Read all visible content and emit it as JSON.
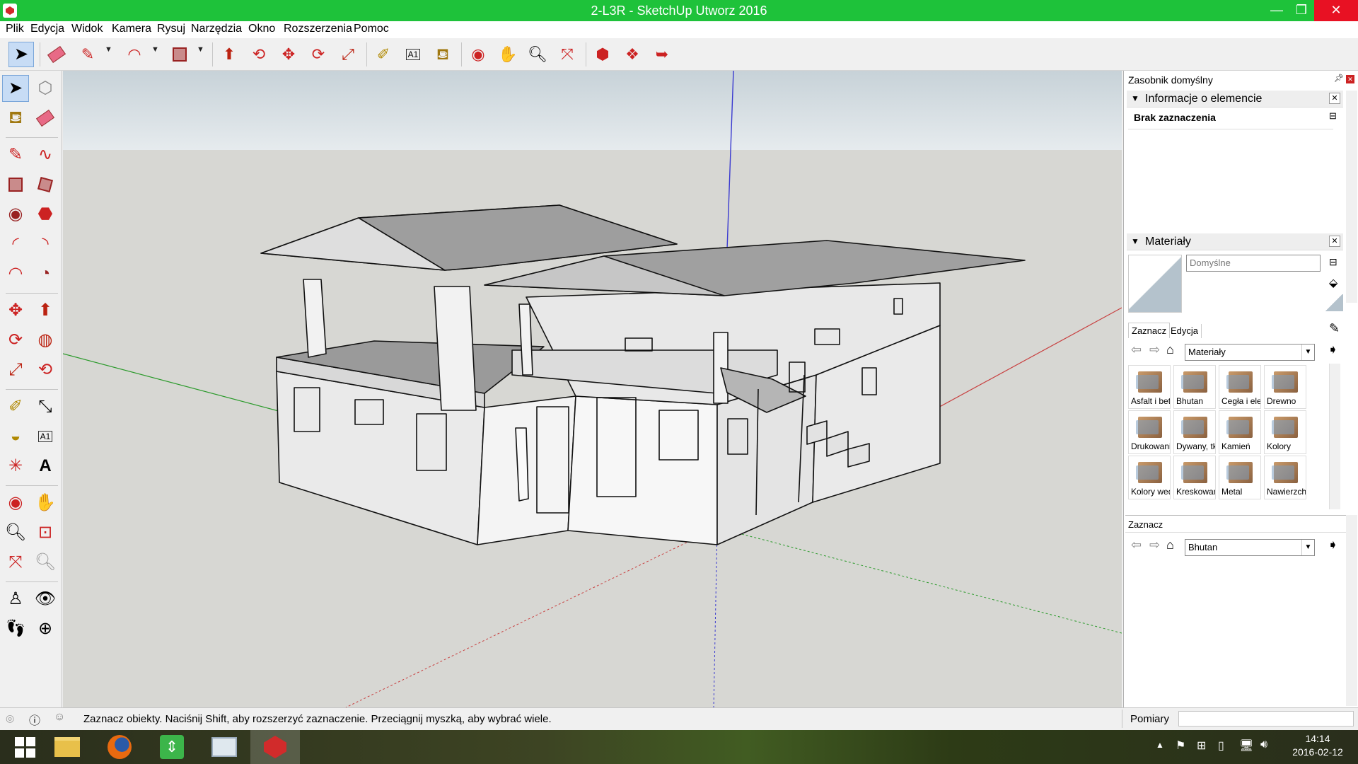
{
  "window": {
    "title": "2-L3R - SketchUp Utworz 2016",
    "accent": "#1ec23a"
  },
  "menu": [
    "Plik",
    "Edycja",
    "Widok",
    "Kamera",
    "Rysuj",
    "Narzędzia",
    "Okno",
    "Rozszerzenia",
    "Pomoc"
  ],
  "toolbar": {
    "tools": [
      {
        "name": "select-tool",
        "icon": "arrow-icon"
      },
      {
        "name": "eraser-tool",
        "icon": "eraser-icon"
      },
      {
        "name": "pencil-tool",
        "icon": "pencil-icon"
      },
      {
        "name": "arc-tool",
        "icon": "arc-icon"
      },
      {
        "name": "rectangle-tool",
        "icon": "rectangle-icon"
      },
      {
        "name": "push-pull-tool",
        "icon": "push-pull-icon"
      },
      {
        "name": "offset-tool",
        "icon": "offset-icon"
      },
      {
        "name": "move-tool",
        "icon": "move-icon"
      },
      {
        "name": "rotate-tool",
        "icon": "rotate-icon"
      },
      {
        "name": "scale-tool",
        "icon": "scale-icon"
      },
      {
        "name": "tape-measure-tool",
        "icon": "tape-icon"
      },
      {
        "name": "text-tool",
        "icon": "text-icon"
      },
      {
        "name": "paint-bucket-tool",
        "icon": "paint-bucket-icon"
      },
      {
        "name": "orbit-tool",
        "icon": "orbit-icon"
      },
      {
        "name": "pan-tool",
        "icon": "hand-icon"
      },
      {
        "name": "zoom-tool",
        "icon": "magnifier-icon"
      },
      {
        "name": "zoom-extents-tool",
        "icon": "zoom-extents-icon"
      },
      {
        "name": "warehouse-tool",
        "icon": "warehouse-icon"
      },
      {
        "name": "extension-warehouse-tool",
        "icon": "extension-icon"
      },
      {
        "name": "send-to-layout-tool",
        "icon": "layout-icon"
      }
    ]
  },
  "panel": {
    "tray_title": "Zasobnik domyślny",
    "entity_info": {
      "title": "Informacje o elemencie",
      "value": "Brak zaznaczenia"
    },
    "materials": {
      "title": "Materiały",
      "name_value": "Domyślne",
      "tabs": [
        "Zaznacz",
        "Edycja"
      ],
      "library": "Materiały",
      "items": [
        "Asfalt i beton",
        "Bhutan",
        "Cegła i elewacja",
        "Drewno",
        "Drukowanie",
        "Dywany, tkaniny",
        "Kamień",
        "Kolory",
        "Kolory według nazw",
        "Kreskowanie",
        "Metal",
        "Nawierzchnie"
      ]
    },
    "secondary": {
      "title": "Zaznacz",
      "library": "Bhutan"
    }
  },
  "status": {
    "hint": "Zaznacz obiekty. Naciśnij Shift, aby rozszerzyć zaznaczenie. Przeciągnij myszką, aby wybrać wiele.",
    "measure_label": "Pomiary",
    "measure_value": ""
  },
  "taskbar": {
    "time": "14:14",
    "date": "2016-02-12"
  }
}
